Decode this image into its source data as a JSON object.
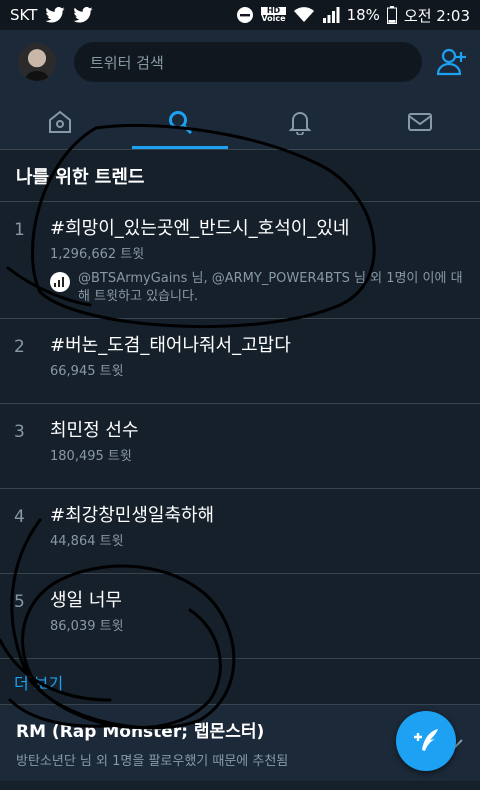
{
  "status_bar": {
    "carrier": "SKT",
    "hd": "HD",
    "voice": "Voice",
    "battery": "18%",
    "time": "오전 2:03"
  },
  "search": {
    "placeholder": "트위터 검색"
  },
  "section_title": "나를 위한 트렌드",
  "trends": [
    {
      "rank": "1",
      "name": "#희망이_있는곳엔_반드시_호석이_있네",
      "count": "1,296,662 트윗",
      "context": "@BTSArmyGains 님, @ARMY_POWER4BTS 님 외 1명이 이에 대해 트윗하고 있습니다."
    },
    {
      "rank": "2",
      "name": "#버논_도겸_태어나줘서_고맙다",
      "count": "66,945 트윗"
    },
    {
      "rank": "3",
      "name": "최민정 선수",
      "count": "180,495 트윗"
    },
    {
      "rank": "4",
      "name": "#최강창민생일축하해",
      "count": "44,864 트윗"
    },
    {
      "rank": "5",
      "name": "생일 너무",
      "count": "86,039 트윗"
    }
  ],
  "more_link": "더 보기",
  "suggestion": {
    "title": "RM (Rap Monster; 랩몬스터)",
    "subtitle": "방탄소년단 님 외 1명을 팔로우했기 때문에 추천됨"
  },
  "colors": {
    "accent": "#1da1f2",
    "background": "#15202b",
    "surface": "#1c2938",
    "muted": "#8899a6"
  },
  "icons": [
    "twitter-icon",
    "minus-circle-icon",
    "wifi-icon",
    "signal-icon",
    "battery-icon",
    "add-user-icon",
    "home-icon",
    "search-icon",
    "bell-icon",
    "mail-icon",
    "chart-icon",
    "compose-icon",
    "chevron-down-icon"
  ]
}
